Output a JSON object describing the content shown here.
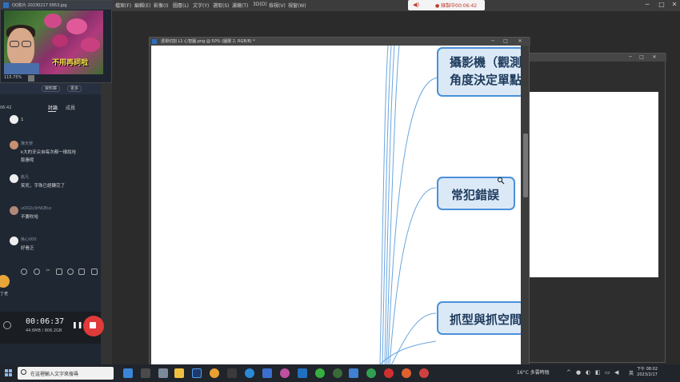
{
  "menubar": {
    "items": [
      "檔案(F)",
      "編輯(E)",
      "影像(I)",
      "圖層(L)",
      "文字(Y)",
      "選取(S)",
      "濾鏡(T)",
      "3D(D)",
      "檢視(V)",
      "視窗(W)",
      "說明(H)"
    ],
    "recording_label": "● 錄製中00:06:42"
  },
  "qq_window": {
    "title": "QQ影片 20230217 0953.jpg",
    "webcam_caption": "不用再詞啦",
    "zoom": "115.75%"
  },
  "chat_panel": {
    "header_buttons": [
      "資料庫",
      "更多"
    ],
    "time_side": "06:42",
    "tabs": [
      "討論",
      "成員"
    ],
    "messages": [
      {
        "name": "",
        "text": "1"
      },
      {
        "name": "陳天使",
        "text": "k大的牙尖自每次都一樣說哇"
      },
      {
        "name": "",
        "text": "膨脹呢"
      },
      {
        "name": "銘凡",
        "text": "笑死，字珠已經轉完了"
      },
      {
        "name": "uOO2z3rNQEuc",
        "text": "不要吹哈"
      },
      {
        "name": "吳心000",
        "text": "好看乏"
      }
    ],
    "left_avatar_label": "丁老"
  },
  "recorder": {
    "time": "00:06:37",
    "size": "44.6MB / 806.2GB"
  },
  "document": {
    "title": "透視切割 L1 心智圖.png @ 50% (圖層 2, RGB/8) *",
    "nodes": [
      "攝影機（觀測",
      "角度決定單點",
      "常犯錯誤",
      "抓型與抓空間"
    ]
  },
  "taskbar": {
    "search_placeholder": "在這裡輸入文字來搜尋",
    "weather": "16°C 多雲時陰",
    "lang": "英",
    "clock_time": "下午 08:02",
    "clock_date": "2023/2/17"
  }
}
